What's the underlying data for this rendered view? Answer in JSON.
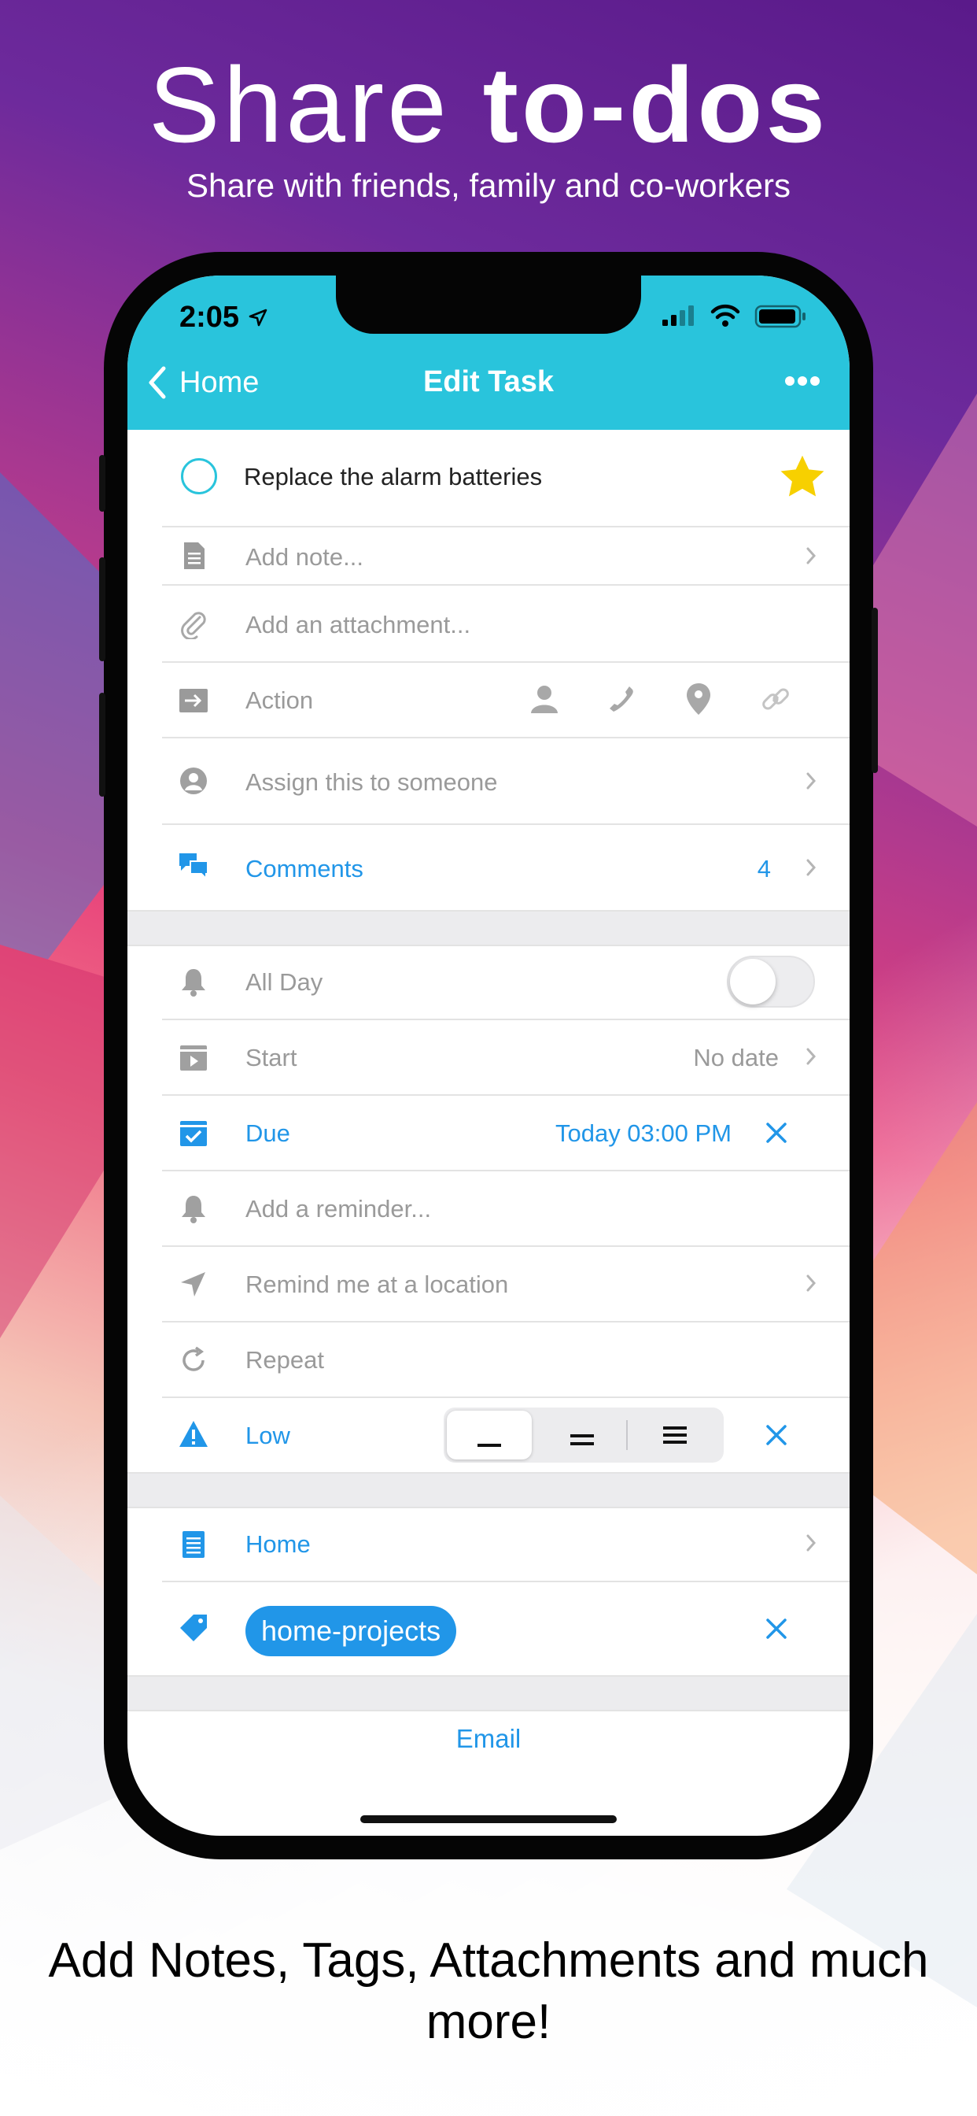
{
  "hero": {
    "title_light": "Share",
    "title_bold": "to-dos",
    "subtitle": "Share with friends, family and co-workers"
  },
  "caption": "Add Notes, Tags, Attachments and much more!",
  "status_bar": {
    "time": "2:05"
  },
  "nav": {
    "back_label": "Home",
    "title": "Edit Task"
  },
  "task": {
    "title": "Replace the alarm batteries",
    "starred": true
  },
  "fields": {
    "note_placeholder": "Add note...",
    "attachment_placeholder": "Add an attachment...",
    "action_label": "Action",
    "assign_label": "Assign this to someone",
    "comments_label": "Comments",
    "comments_count": "4",
    "all_day_label": "All Day",
    "all_day_on": false,
    "start_label": "Start",
    "start_value": "No date",
    "due_label": "Due",
    "due_value": "Today 03:00 PM",
    "reminder_placeholder": "Add a reminder...",
    "location_label": "Remind me at a location",
    "repeat_label": "Repeat",
    "priority_label": "Low",
    "priority_options": [
      "low",
      "medium",
      "high"
    ],
    "priority_selected": "low",
    "list_label": "Home",
    "tag_label": "home-projects"
  },
  "footer": {
    "email_label": "Email"
  },
  "colors": {
    "accent": "#2196e8",
    "topbar": "#29c4dc",
    "star": "#f7d000"
  }
}
